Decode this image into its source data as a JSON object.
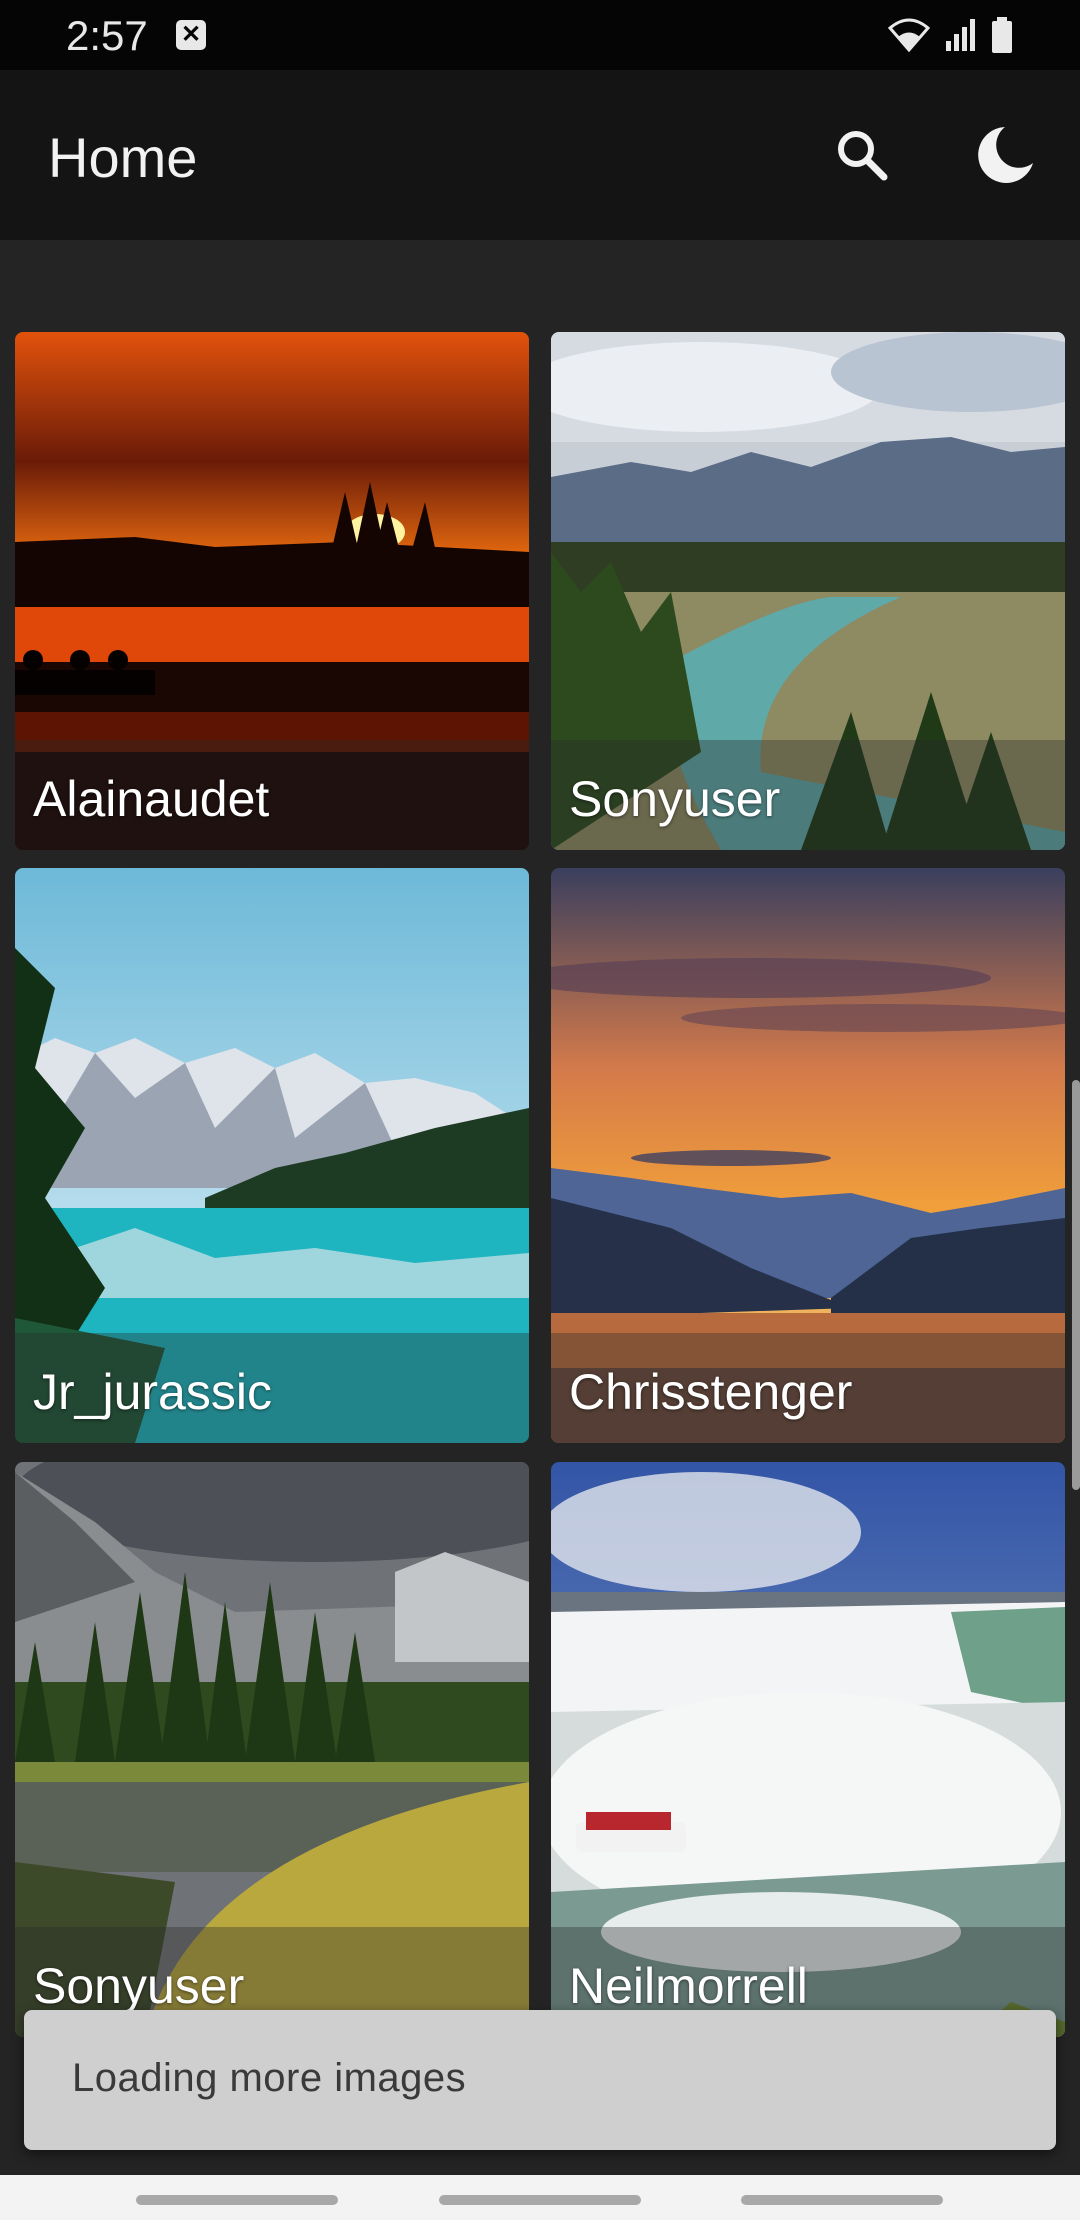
{
  "status_bar": {
    "time": "2:57",
    "notification_icon": "x-box-icon",
    "icons": [
      "wifi-icon",
      "signal-icon",
      "battery-icon"
    ]
  },
  "app_bar": {
    "title": "Home",
    "actions": [
      {
        "name": "search-button",
        "icon": "search-icon"
      },
      {
        "name": "dark-mode-button",
        "icon": "moon-icon"
      }
    ]
  },
  "photos": [
    {
      "author": "Alainaudet",
      "scene": "sunset lake"
    },
    {
      "author": "Sonyuser",
      "scene": "mountain river"
    },
    {
      "author": "Jr_jurassic",
      "scene": "turquoise lake"
    },
    {
      "author": "Chrisstenger",
      "scene": "orange sky mountains"
    },
    {
      "author": "Sonyuser",
      "scene": "forest pond"
    },
    {
      "author": "Neilmorrell",
      "scene": "waterfall"
    }
  ],
  "snackbar": {
    "message": "Loading more images"
  },
  "colors": {
    "background": "#242424",
    "app_bar": "#141414",
    "status_bar": "#050505",
    "snackbar": "#cfcfcf"
  }
}
